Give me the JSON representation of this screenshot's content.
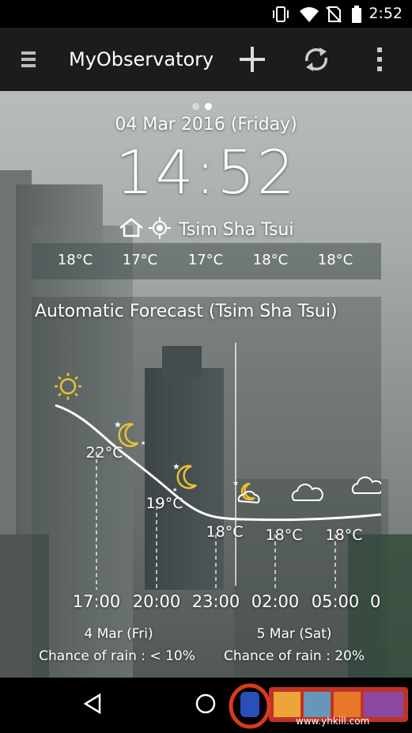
{
  "status_bar": {
    "time": "2:52",
    "icons": [
      "vibrate-icon",
      "wifi-icon",
      "no-sim-icon",
      "battery-icon"
    ]
  },
  "app_bar": {
    "title": "MyObservatory",
    "actions": [
      "menu-icon",
      "add-icon",
      "refresh-icon",
      "overflow-menu-icon"
    ]
  },
  "main": {
    "page_indicator": {
      "count": 2,
      "active": 2
    },
    "date": "04 Mar 2016 (Friday)",
    "time": "14:52",
    "location": "Tsim Sha Tsui",
    "temperature_strip": [
      "18°C",
      "17°C",
      "17°C",
      "18°C",
      "18°C"
    ],
    "forecast": {
      "title": "Automatic Forecast (Tsim Sha Tsui)",
      "temperatures": [
        "22°C",
        "19°C",
        "18°C",
        "18°C",
        "18°C"
      ],
      "hours": [
        "17:00",
        "20:00",
        "23:00",
        "02:00",
        "05:00",
        "0"
      ],
      "days": [
        {
          "date": "4 Mar (Fri)",
          "rain": "Chance of rain : < 10%"
        },
        {
          "date": "5 Mar (Sat)",
          "rain": "Chance of rain : 20%"
        }
      ],
      "weather_icons": [
        "sunny-icon",
        "night-clear-icon",
        "night-clear-icon",
        "night-partly-cloudy-icon",
        "cloudy-icon",
        "cloudy-icon"
      ]
    }
  },
  "nav_bar": [
    "back-icon",
    "home-icon"
  ],
  "watermark": {
    "domain": "www.yhkill.com"
  }
}
